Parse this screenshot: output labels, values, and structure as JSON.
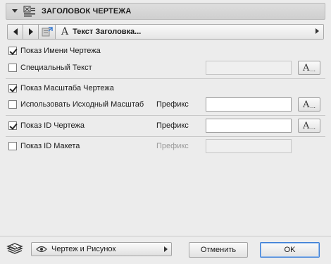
{
  "header": {
    "title": "ЗАГОЛОВОК ЧЕРТЕЖА",
    "icon": "drawing-title-icon"
  },
  "navbar": {
    "prev_icon": "arrow-left-icon",
    "next_icon": "arrow-right-icon",
    "settings_icon": "title-settings-icon",
    "font_icon": "font-a-icon",
    "field_text": "Текст Заголовка..."
  },
  "rows": {
    "show_drawing_name": {
      "label": "Показ Имени Чертежа",
      "checked": true
    },
    "special_text": {
      "label": "Специальный Текст",
      "checked": false,
      "value": ""
    },
    "show_drawing_scale": {
      "label": "Показ Масштаба Чертежа",
      "checked": true
    },
    "use_original_scale": {
      "label": "Использовать Исходный Масштаб",
      "checked": false,
      "prefix_label": "Префикс",
      "value": ""
    },
    "show_drawing_id": {
      "label": "Показ ID Чертежа",
      "checked": true,
      "prefix_label": "Префикс",
      "value": ""
    },
    "show_layout_id": {
      "label": "Показ ID Макета",
      "checked": false,
      "prefix_label": "Префикс",
      "value": ""
    }
  },
  "font_button": {
    "glyph": "A",
    "dots": "..."
  },
  "footer": {
    "view_dropdown": "Чертеж и Рисунок",
    "cancel_label": "Отменить",
    "ok_label": "OK"
  },
  "colors": {
    "accent_focus": "#3d7fd6",
    "background": "#ececec"
  }
}
